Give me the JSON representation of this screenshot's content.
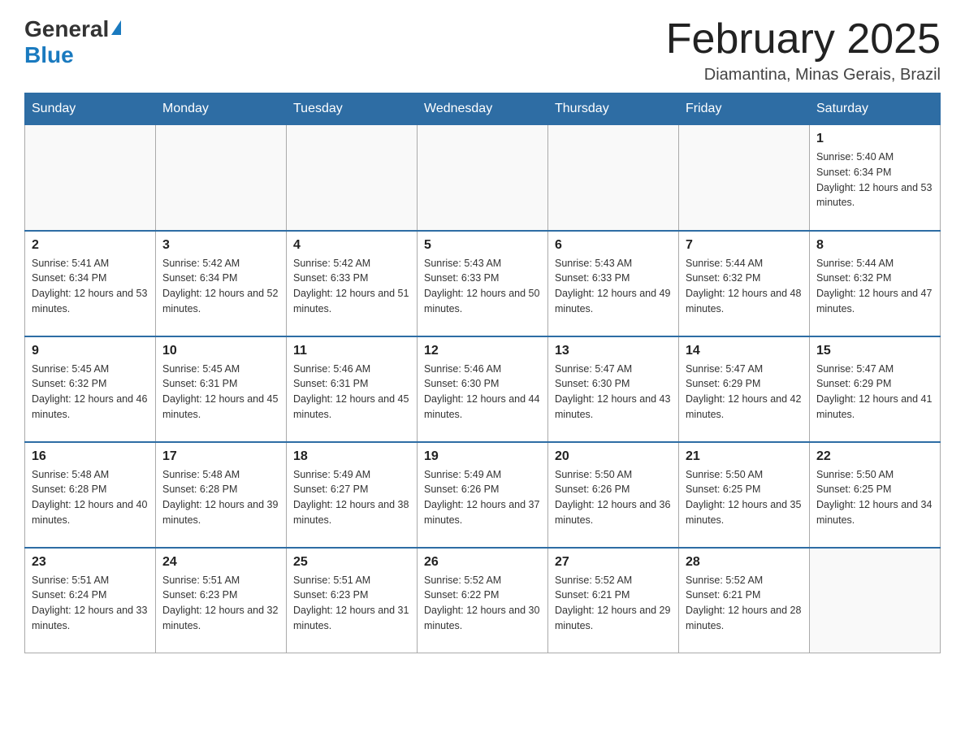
{
  "header": {
    "logo_general": "General",
    "logo_blue": "Blue",
    "month_title": "February 2025",
    "location": "Diamantina, Minas Gerais, Brazil"
  },
  "days_of_week": [
    "Sunday",
    "Monday",
    "Tuesday",
    "Wednesday",
    "Thursday",
    "Friday",
    "Saturday"
  ],
  "weeks": [
    [
      {
        "day": "",
        "sunrise": "",
        "sunset": "",
        "daylight": ""
      },
      {
        "day": "",
        "sunrise": "",
        "sunset": "",
        "daylight": ""
      },
      {
        "day": "",
        "sunrise": "",
        "sunset": "",
        "daylight": ""
      },
      {
        "day": "",
        "sunrise": "",
        "sunset": "",
        "daylight": ""
      },
      {
        "day": "",
        "sunrise": "",
        "sunset": "",
        "daylight": ""
      },
      {
        "day": "",
        "sunrise": "",
        "sunset": "",
        "daylight": ""
      },
      {
        "day": "1",
        "sunrise": "Sunrise: 5:40 AM",
        "sunset": "Sunset: 6:34 PM",
        "daylight": "Daylight: 12 hours and 53 minutes."
      }
    ],
    [
      {
        "day": "2",
        "sunrise": "Sunrise: 5:41 AM",
        "sunset": "Sunset: 6:34 PM",
        "daylight": "Daylight: 12 hours and 53 minutes."
      },
      {
        "day": "3",
        "sunrise": "Sunrise: 5:42 AM",
        "sunset": "Sunset: 6:34 PM",
        "daylight": "Daylight: 12 hours and 52 minutes."
      },
      {
        "day": "4",
        "sunrise": "Sunrise: 5:42 AM",
        "sunset": "Sunset: 6:33 PM",
        "daylight": "Daylight: 12 hours and 51 minutes."
      },
      {
        "day": "5",
        "sunrise": "Sunrise: 5:43 AM",
        "sunset": "Sunset: 6:33 PM",
        "daylight": "Daylight: 12 hours and 50 minutes."
      },
      {
        "day": "6",
        "sunrise": "Sunrise: 5:43 AM",
        "sunset": "Sunset: 6:33 PM",
        "daylight": "Daylight: 12 hours and 49 minutes."
      },
      {
        "day": "7",
        "sunrise": "Sunrise: 5:44 AM",
        "sunset": "Sunset: 6:32 PM",
        "daylight": "Daylight: 12 hours and 48 minutes."
      },
      {
        "day": "8",
        "sunrise": "Sunrise: 5:44 AM",
        "sunset": "Sunset: 6:32 PM",
        "daylight": "Daylight: 12 hours and 47 minutes."
      }
    ],
    [
      {
        "day": "9",
        "sunrise": "Sunrise: 5:45 AM",
        "sunset": "Sunset: 6:32 PM",
        "daylight": "Daylight: 12 hours and 46 minutes."
      },
      {
        "day": "10",
        "sunrise": "Sunrise: 5:45 AM",
        "sunset": "Sunset: 6:31 PM",
        "daylight": "Daylight: 12 hours and 45 minutes."
      },
      {
        "day": "11",
        "sunrise": "Sunrise: 5:46 AM",
        "sunset": "Sunset: 6:31 PM",
        "daylight": "Daylight: 12 hours and 45 minutes."
      },
      {
        "day": "12",
        "sunrise": "Sunrise: 5:46 AM",
        "sunset": "Sunset: 6:30 PM",
        "daylight": "Daylight: 12 hours and 44 minutes."
      },
      {
        "day": "13",
        "sunrise": "Sunrise: 5:47 AM",
        "sunset": "Sunset: 6:30 PM",
        "daylight": "Daylight: 12 hours and 43 minutes."
      },
      {
        "day": "14",
        "sunrise": "Sunrise: 5:47 AM",
        "sunset": "Sunset: 6:29 PM",
        "daylight": "Daylight: 12 hours and 42 minutes."
      },
      {
        "day": "15",
        "sunrise": "Sunrise: 5:47 AM",
        "sunset": "Sunset: 6:29 PM",
        "daylight": "Daylight: 12 hours and 41 minutes."
      }
    ],
    [
      {
        "day": "16",
        "sunrise": "Sunrise: 5:48 AM",
        "sunset": "Sunset: 6:28 PM",
        "daylight": "Daylight: 12 hours and 40 minutes."
      },
      {
        "day": "17",
        "sunrise": "Sunrise: 5:48 AM",
        "sunset": "Sunset: 6:28 PM",
        "daylight": "Daylight: 12 hours and 39 minutes."
      },
      {
        "day": "18",
        "sunrise": "Sunrise: 5:49 AM",
        "sunset": "Sunset: 6:27 PM",
        "daylight": "Daylight: 12 hours and 38 minutes."
      },
      {
        "day": "19",
        "sunrise": "Sunrise: 5:49 AM",
        "sunset": "Sunset: 6:26 PM",
        "daylight": "Daylight: 12 hours and 37 minutes."
      },
      {
        "day": "20",
        "sunrise": "Sunrise: 5:50 AM",
        "sunset": "Sunset: 6:26 PM",
        "daylight": "Daylight: 12 hours and 36 minutes."
      },
      {
        "day": "21",
        "sunrise": "Sunrise: 5:50 AM",
        "sunset": "Sunset: 6:25 PM",
        "daylight": "Daylight: 12 hours and 35 minutes."
      },
      {
        "day": "22",
        "sunrise": "Sunrise: 5:50 AM",
        "sunset": "Sunset: 6:25 PM",
        "daylight": "Daylight: 12 hours and 34 minutes."
      }
    ],
    [
      {
        "day": "23",
        "sunrise": "Sunrise: 5:51 AM",
        "sunset": "Sunset: 6:24 PM",
        "daylight": "Daylight: 12 hours and 33 minutes."
      },
      {
        "day": "24",
        "sunrise": "Sunrise: 5:51 AM",
        "sunset": "Sunset: 6:23 PM",
        "daylight": "Daylight: 12 hours and 32 minutes."
      },
      {
        "day": "25",
        "sunrise": "Sunrise: 5:51 AM",
        "sunset": "Sunset: 6:23 PM",
        "daylight": "Daylight: 12 hours and 31 minutes."
      },
      {
        "day": "26",
        "sunrise": "Sunrise: 5:52 AM",
        "sunset": "Sunset: 6:22 PM",
        "daylight": "Daylight: 12 hours and 30 minutes."
      },
      {
        "day": "27",
        "sunrise": "Sunrise: 5:52 AM",
        "sunset": "Sunset: 6:21 PM",
        "daylight": "Daylight: 12 hours and 29 minutes."
      },
      {
        "day": "28",
        "sunrise": "Sunrise: 5:52 AM",
        "sunset": "Sunset: 6:21 PM",
        "daylight": "Daylight: 12 hours and 28 minutes."
      },
      {
        "day": "",
        "sunrise": "",
        "sunset": "",
        "daylight": ""
      }
    ]
  ]
}
